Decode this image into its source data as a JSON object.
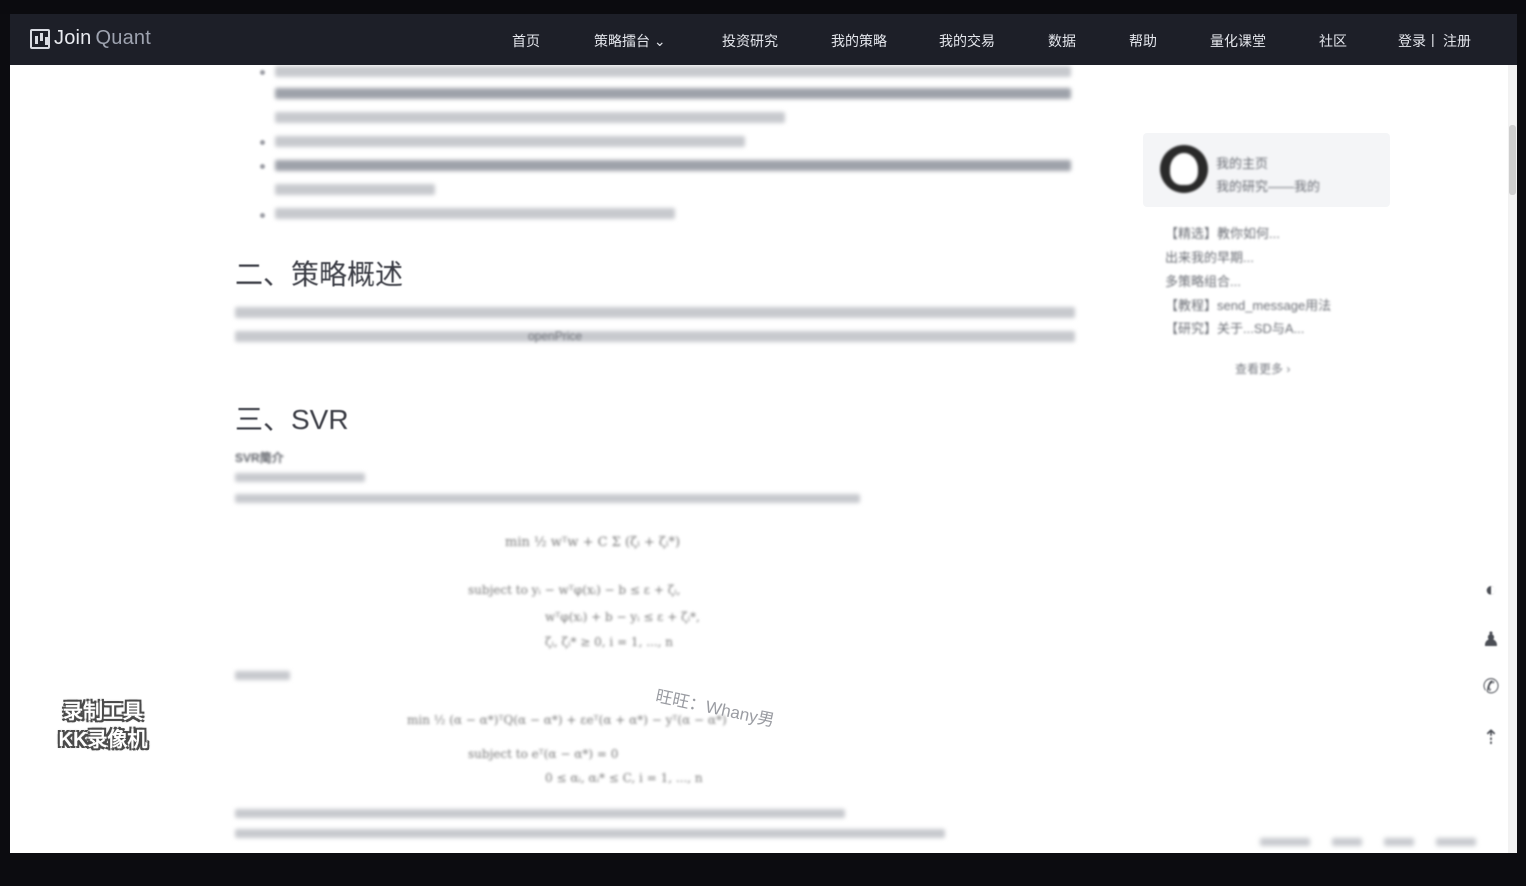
{
  "navbar": {
    "logo": {
      "main": "Join",
      "sub": "Quant"
    },
    "items": [
      "首页",
      "策略擂台",
      "投资研究",
      "我的策略",
      "我的交易",
      "数据",
      "帮助",
      "量化课堂",
      "社区",
      "登录",
      "注册"
    ],
    "separator": "|"
  },
  "article": {
    "section2_title": "二、策略概述",
    "section3_title": "三、SVR",
    "svr_label": "SVR简介",
    "text_openprice": "openPrice"
  },
  "sidebar": {
    "card_title": "我的主页",
    "card_subtitle": "我的研究——我的",
    "links": [
      "【精选】教你如何...",
      "出来我的早期...",
      "多策略组合...",
      "【教程】send_message用法",
      "【研究】关于...SD与A..."
    ],
    "more": "查看更多 ›"
  },
  "overlay": {
    "watermark_line1": "录制工具",
    "watermark_line2": "KK录像机",
    "note": "旺旺：Whany男"
  },
  "floating_tools": [
    "wechat-icon",
    "qq-icon",
    "phone-icon",
    "back-to-top-icon"
  ]
}
